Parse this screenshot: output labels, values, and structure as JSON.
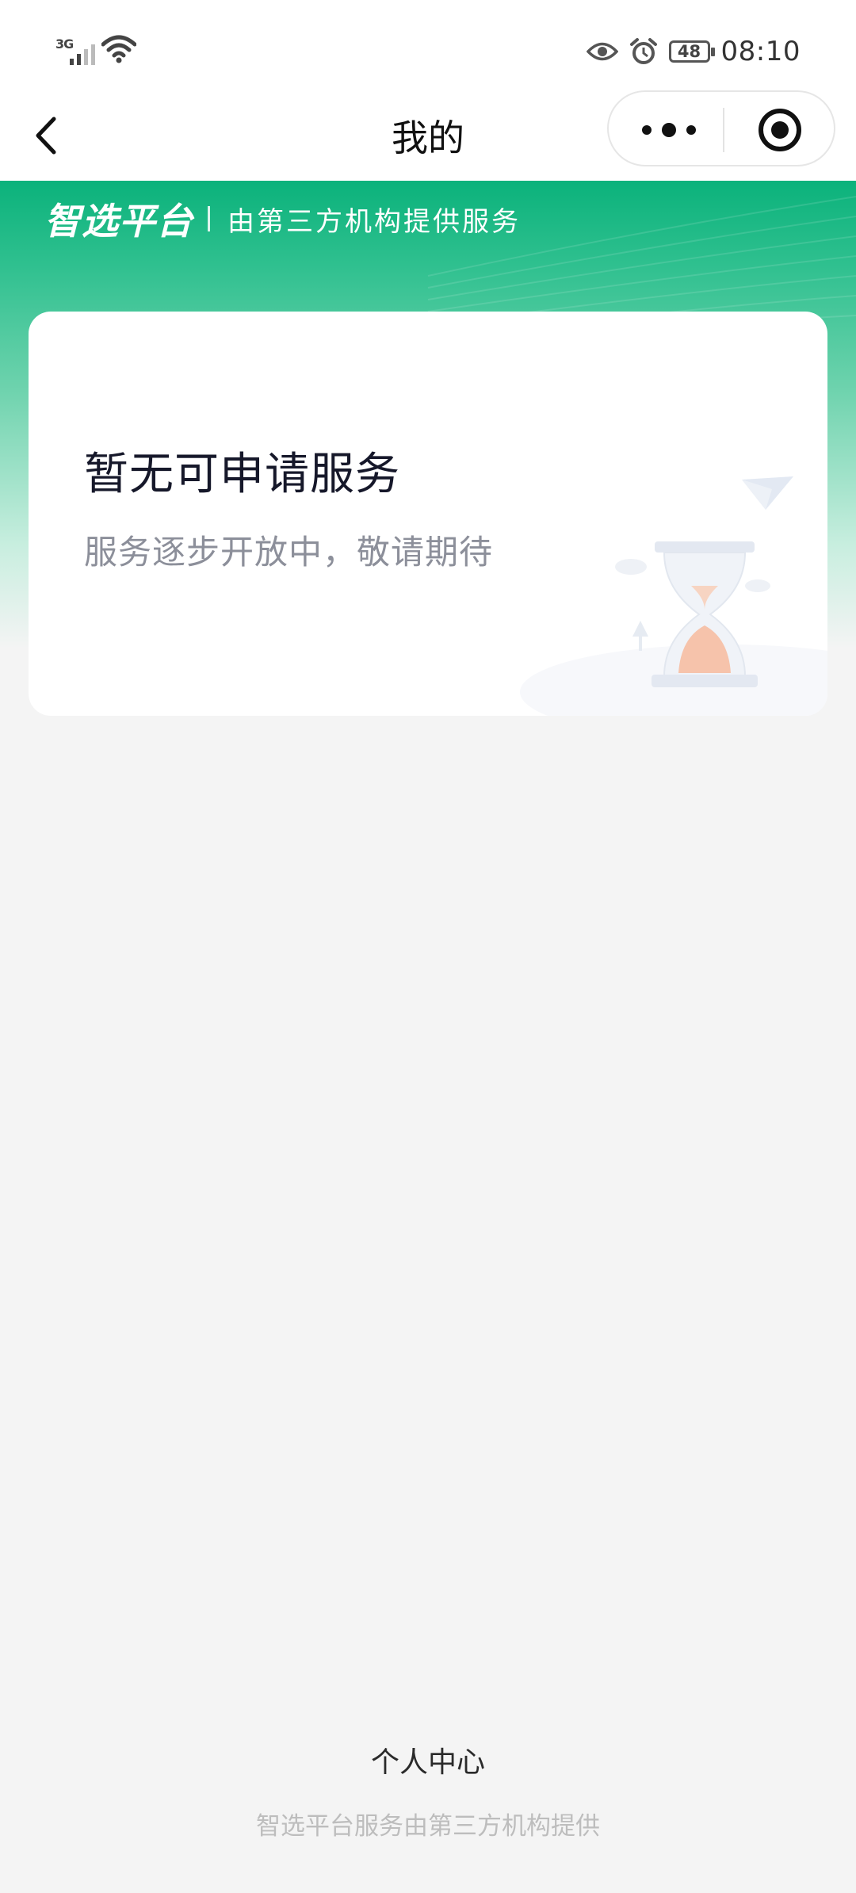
{
  "status_bar": {
    "network": "3G",
    "battery": "48",
    "time": "08:10"
  },
  "nav": {
    "title": "我的"
  },
  "header": {
    "brand": "智选平台",
    "subtitle": "由第三方机构提供服务"
  },
  "empty_state": {
    "title": "暂无可申请服务",
    "subtitle": "服务逐步开放中，敬请期待"
  },
  "footer": {
    "title": "个人中心",
    "note": "智选平台服务由第三方机构提供"
  },
  "colors": {
    "brand_green": "#0bb27b",
    "page_bg": "#f4f4f4"
  }
}
